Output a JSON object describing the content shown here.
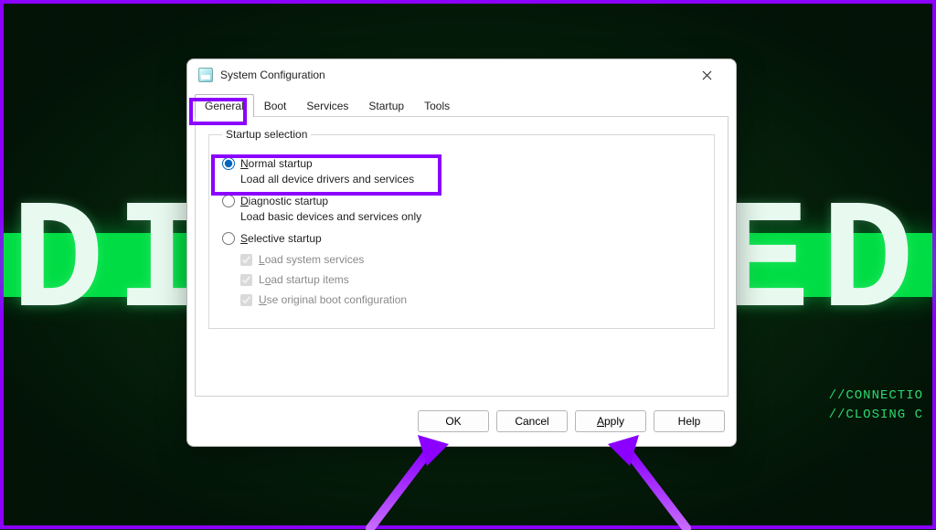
{
  "background": {
    "left_text": "DIS",
    "right_text": "TED",
    "side_lines": {
      "l1": "//CONNECTIO",
      "l2": "//CLOSING C"
    }
  },
  "dialog": {
    "title": "System Configuration",
    "tabs": {
      "general": "General",
      "boot": "Boot",
      "services": "Services",
      "startup": "Startup",
      "tools": "Tools"
    },
    "group_legend": "Startup selection",
    "options": {
      "normal": {
        "label_pre": "",
        "label_u": "N",
        "label_post": "ormal startup",
        "desc": "Load all device drivers and services"
      },
      "diagnostic": {
        "label_pre": "",
        "label_u": "D",
        "label_post": "iagnostic startup",
        "desc": "Load basic devices and services only"
      },
      "selective": {
        "label_pre": "",
        "label_u": "S",
        "label_post": "elective startup"
      }
    },
    "checks": {
      "sys_pre": "",
      "sys_u": "L",
      "sys_post": "oad system services",
      "startup_pre": "L",
      "startup_u": "o",
      "startup_post": "ad startup items",
      "orig_pre": "",
      "orig_u": "U",
      "orig_post": "se original boot configuration"
    },
    "buttons": {
      "ok": "OK",
      "cancel": "Cancel",
      "apply_pre": "",
      "apply_u": "A",
      "apply_post": "pply",
      "help": "Help"
    }
  }
}
